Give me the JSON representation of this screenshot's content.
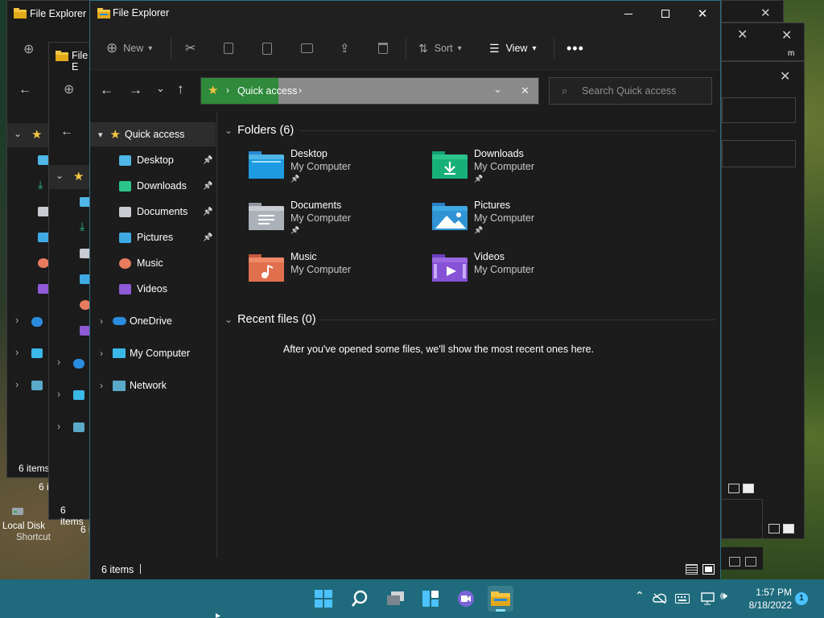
{
  "window": {
    "title": "File Explorer"
  },
  "background_windows": [
    {
      "title": "File Explorer",
      "status": "6 items"
    },
    {
      "title": "File E",
      "status": "6 items"
    },
    {
      "title": "6 i"
    },
    {
      "title": "6 i"
    }
  ],
  "desktop": {
    "shortcut_label": "Local Disk",
    "shortcut_label2": "Shortcut"
  },
  "toolbar": {
    "new_label": "New",
    "sort_label": "Sort",
    "view_label": "View"
  },
  "address": {
    "crumb": "Quick access"
  },
  "search": {
    "placeholder": "Search Quick access"
  },
  "nav_pane": {
    "quick_access": "Quick access",
    "items": [
      {
        "label": "Desktop",
        "icon": "desktop-icon",
        "pinned": true
      },
      {
        "label": "Downloads",
        "icon": "downloads-icon",
        "pinned": true
      },
      {
        "label": "Documents",
        "icon": "documents-icon",
        "pinned": true
      },
      {
        "label": "Pictures",
        "icon": "pictures-icon",
        "pinned": true
      },
      {
        "label": "Music",
        "icon": "music-icon",
        "pinned": false
      },
      {
        "label": "Videos",
        "icon": "videos-icon",
        "pinned": false
      }
    ],
    "onedrive": "OneDrive",
    "my_computer": "My Computer",
    "network": "Network"
  },
  "content": {
    "folders_header": "Folders (6)",
    "folders": [
      {
        "name": "Desktop",
        "location": "My Computer",
        "pinned": true
      },
      {
        "name": "Downloads",
        "location": "My Computer",
        "pinned": true
      },
      {
        "name": "Documents",
        "location": "My Computer",
        "pinned": true
      },
      {
        "name": "Pictures",
        "location": "My Computer",
        "pinned": true
      },
      {
        "name": "Music",
        "location": "My Computer",
        "pinned": false
      },
      {
        "name": "Videos",
        "location": "My Computer",
        "pinned": false
      }
    ],
    "recent_header": "Recent files (0)",
    "recent_empty": "After you've opened some files, we'll show the most recent ones here."
  },
  "status": {
    "count": "6 items"
  },
  "taskbar": {
    "time": "1:57 PM",
    "date": "8/18/2022",
    "badge": "1"
  },
  "colors": {
    "accent": "#1f6b7d",
    "addressGreen": "#2f8a3b",
    "folderYellow": "#f4c542"
  }
}
